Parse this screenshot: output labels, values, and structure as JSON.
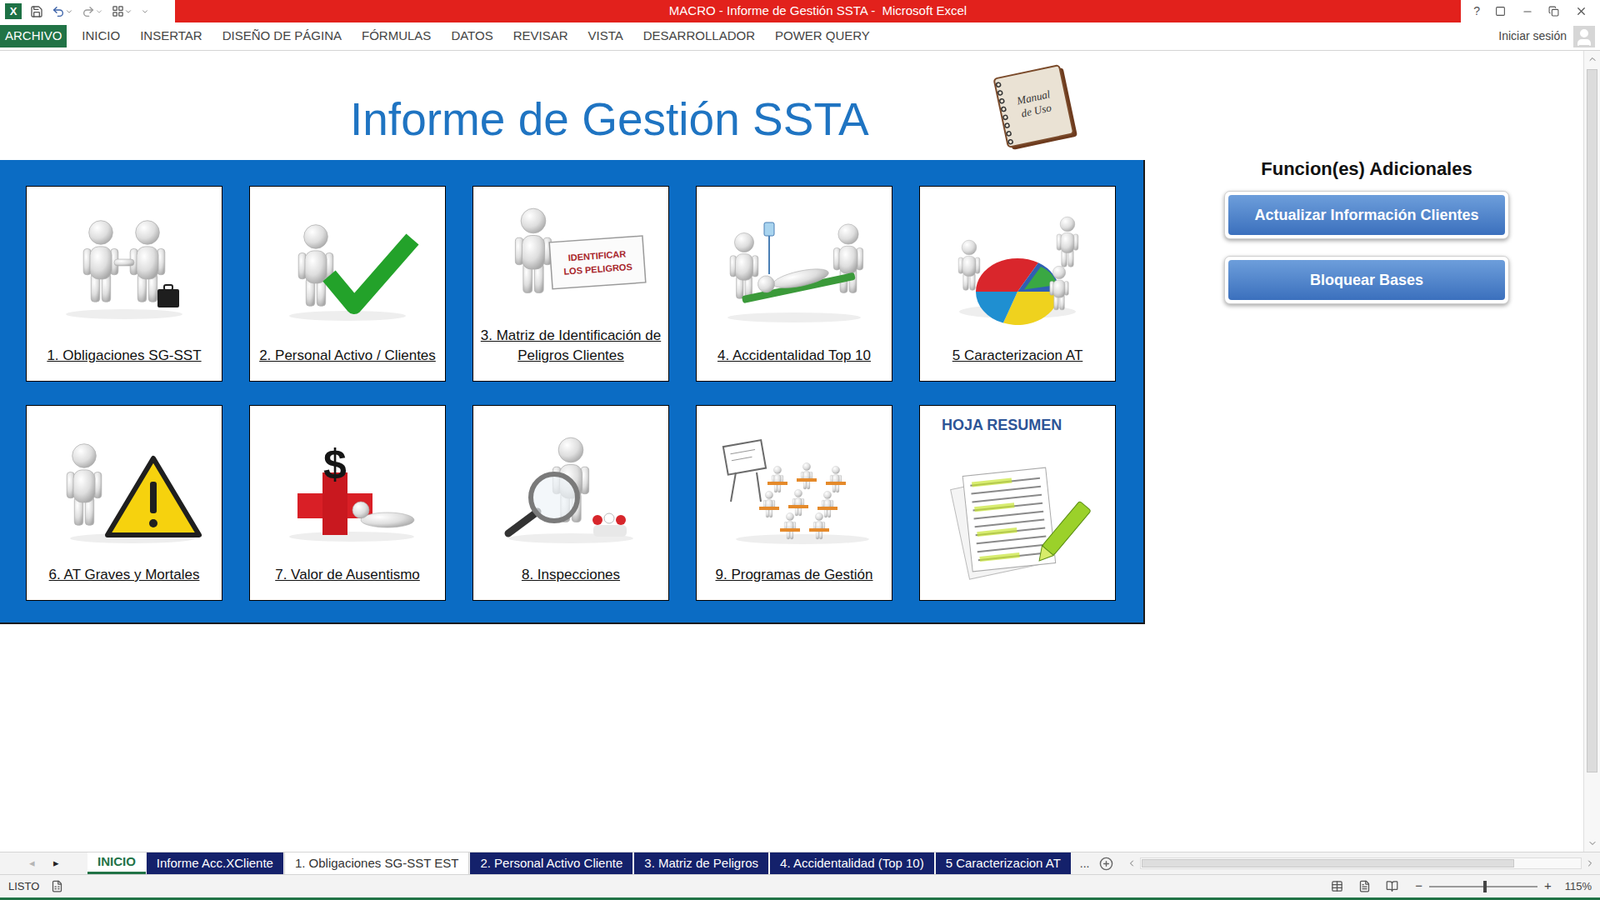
{
  "window": {
    "app_icon": "X",
    "title": "MACRO - Informe de Gestión SSTA -  Microsoft Excel",
    "help": "?"
  },
  "ribbon_tabs": [
    {
      "label": "ARCHIVO",
      "selected": true
    },
    {
      "label": "INICIO",
      "selected": false
    },
    {
      "label": "INSERTAR",
      "selected": false
    },
    {
      "label": "DISEÑO DE PÁGINA",
      "selected": false
    },
    {
      "label": "FÓRMULAS",
      "selected": false
    },
    {
      "label": "DATOS",
      "selected": false
    },
    {
      "label": "REVISAR",
      "selected": false
    },
    {
      "label": "VISTA",
      "selected": false
    },
    {
      "label": "DESARROLLADOR",
      "selected": false
    },
    {
      "label": "POWER QUERY",
      "selected": false
    }
  ],
  "account": {
    "label": "Iniciar sesión"
  },
  "sheet": {
    "title": "Informe de Gestión SSTA",
    "manual": [
      "Manual",
      "de Uso"
    ],
    "cards": [
      {
        "label": "1. Obligaciones SG-SST",
        "kind": "handshake"
      },
      {
        "label": "2. Personal Activo / Clientes",
        "kind": "check"
      },
      {
        "label": "3. Matriz de Identificación de Peligros Clientes",
        "kind": "sign",
        "sign_text": [
          "IDENTIFICAR",
          "LOS PELIGROS"
        ]
      },
      {
        "label": "4. Accidentalidad Top 10",
        "kind": "stretcher"
      },
      {
        "label": "5 Caracterizacion AT",
        "kind": "piechart"
      },
      {
        "label": "6. AT Graves y Mortales",
        "kind": "warning"
      },
      {
        "label": "7. Valor de Ausentismo",
        "kind": "money",
        "symbol": "$"
      },
      {
        "label": "8. Inspecciones",
        "kind": "magnifier"
      },
      {
        "label": "9. Programas de Gestión",
        "kind": "classroom"
      },
      {
        "label": "HOJA RESUMEN",
        "kind": "resumen"
      }
    ]
  },
  "side_panel": {
    "heading": "Funcion(es) Adicionales",
    "buttons": [
      "Actualizar Información Clientes",
      "Bloquear Bases"
    ]
  },
  "sheet_tabs": {
    "nav": [
      "◂",
      "▸"
    ],
    "more": "...",
    "tabs": [
      {
        "label": "INICIO",
        "selected": true,
        "color": "#ffffff"
      },
      {
        "label": "Informe Acc.XCliente",
        "selected": false,
        "color": "#14216b"
      },
      {
        "label": "1. Obligaciones SG-SST EST",
        "selected": false,
        "color": "#ffffff"
      },
      {
        "label": "2. Personal Activo Cliente",
        "selected": false,
        "color": "#14216b"
      },
      {
        "label": "3. Matriz de Peligros",
        "selected": false,
        "color": "#14216b"
      },
      {
        "label": "4. Accidentalidad (Top 10)",
        "selected": false,
        "color": "#14216b"
      },
      {
        "label": "5 Caracterizacion AT",
        "selected": false,
        "color": "#14216b"
      }
    ]
  },
  "status_bar": {
    "status": "LISTO",
    "zoom_out": "−",
    "zoom_in": "+",
    "zoom": "115%",
    "zoom_level": 0.5
  }
}
